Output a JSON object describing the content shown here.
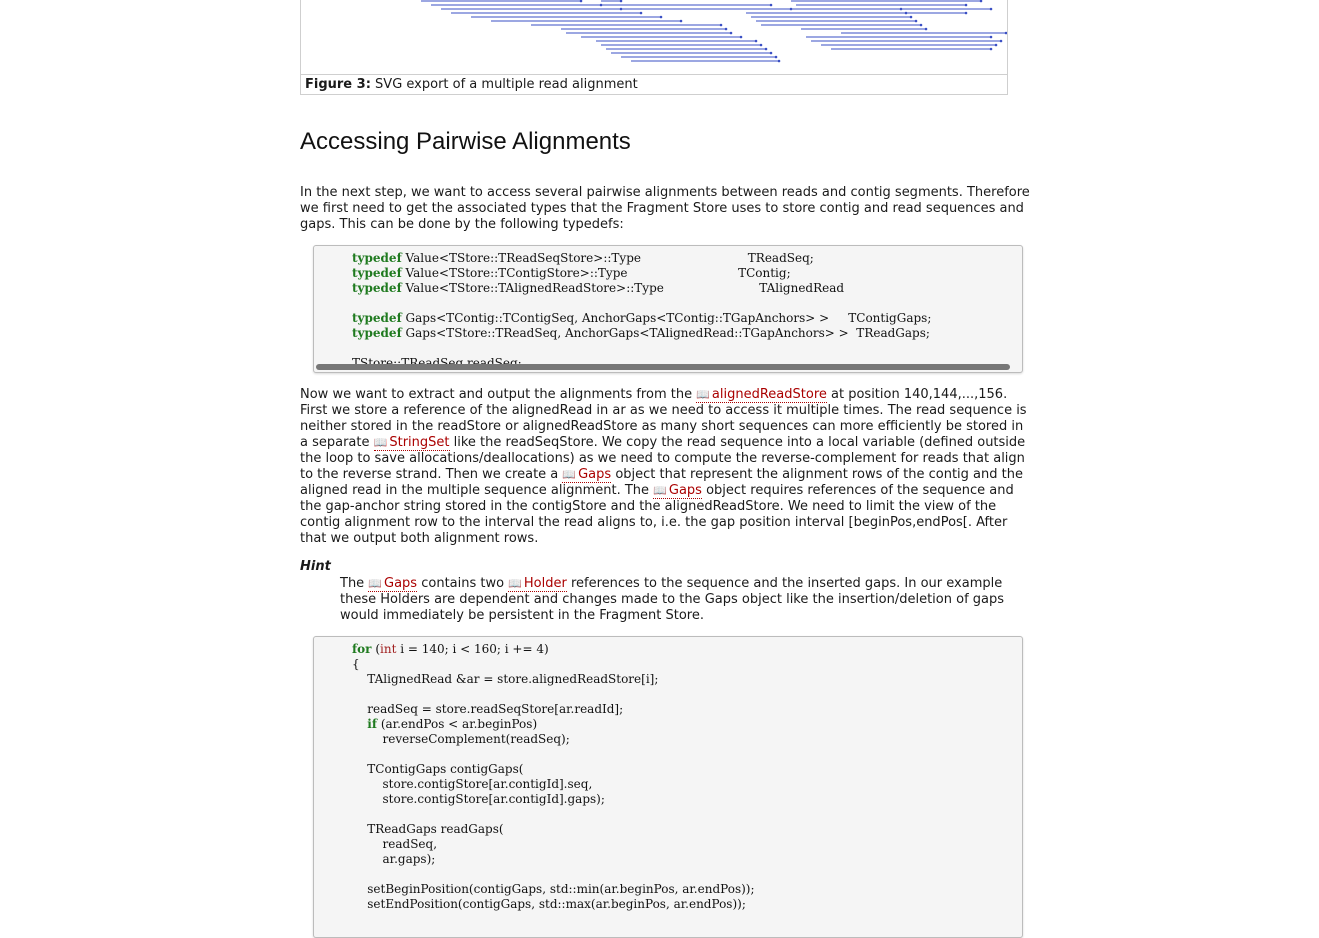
{
  "figure": {
    "caption_label": "Figure 3:",
    "caption_text": "SVG export of a multiple read alignment",
    "line_color": "#3a4fc4"
  },
  "section": {
    "heading": "Accessing Pairwise Alignments"
  },
  "intro": {
    "text": "In the next step, we want to access several pairwise alignments between reads and contig segments. Therefore we first need to get the associated types that the Fragment Store uses to store contig and read sequences and gaps. This can be done by the following typedefs:"
  },
  "code1": {
    "lines": [
      [
        "typedef",
        " Value<TStore::TReadSeqStore>::Type",
        "                            TReadSeq;"
      ],
      [
        "typedef",
        " Value<TStore::TContigStore>::Type",
        "                             TContig;"
      ],
      [
        "typedef",
        " Value<TStore::TAlignedReadStore>::Type",
        "                         TAlignedRead"
      ],
      [
        "",
        "",
        ""
      ],
      [
        "typedef",
        " Gaps<TContig::TContigSeq, AnchorGaps<TContig::TGapAnchors> >",
        "     TContigGaps;"
      ],
      [
        "typedef",
        " Gaps<TStore::TReadSeq, AnchorGaps<TAlignedRead::TGapAnchors> >",
        "  TReadGaps;"
      ],
      [
        "",
        "",
        ""
      ],
      [
        "",
        "TStore::TReadSeq readSeq;",
        ""
      ]
    ]
  },
  "para2": {
    "t1": "Now we want to extract and output the alignments from the ",
    "link1": "alignedReadStore",
    "t2": " at position 140,144,...,156. First we store a reference of the alignedRead in ar as we need to access it multiple times. The read sequence is neither stored in the readStore or alignedReadStore as many short sequences can more efficiently be stored in a separate ",
    "link2": "StringSet",
    "t3": " like the readSeqStore. We copy the read sequence into a local variable (defined outside the loop to save allocations/deallocations) as we need to compute the reverse-complement for reads that align to the reverse strand. Then we create a ",
    "link3": "Gaps",
    "t4": " object that represent the alignment rows of the contig and the aligned read in the multiple sequence alignment. The ",
    "link4": "Gaps",
    "t5": " object requires references of the sequence and the gap-anchor string stored in the contigStore and the alignedReadStore. We need to limit the view of the contig alignment row to the interval the read aligns to, i.e. the gap position interval [beginPos,endPos[. After that we output both alignment rows."
  },
  "hint": {
    "title": "Hint",
    "t1": "The ",
    "link1": "Gaps",
    "t2": " contains two ",
    "link2": "Holder",
    "t3": " references to the sequence and the inserted gaps. In our example these Holders are dependent and changes made to the Gaps object like the insertion/deletion of gaps would immediately be persistent in the Fragment Store."
  },
  "code2": {
    "for_kw": "for",
    "for_open": " (",
    "int_kw": "int",
    "for_rest": " i = 140; i < 160; i += 4)",
    "brace": "{",
    "l1": "    TAlignedRead &ar = store.alignedReadStore[i];",
    "l2": "    readSeq = store.readSeqStore[ar.readId];",
    "if_kw": "if",
    "l3": " (ar.endPos < ar.beginPos)",
    "l4": "        reverseComplement(readSeq);",
    "l5": "    TContigGaps contigGaps(",
    "l6": "        store.contigStore[ar.contigId].seq,",
    "l7": "        store.contigStore[ar.contigId].gaps);",
    "l8": "    TReadGaps readGaps(",
    "l9": "        readSeq,",
    "l10": "        ar.gaps);",
    "l11": "    setBeginPosition(contigGaps, std::min(ar.beginPos, ar.endPos));",
    "l12": "    setEndPosition(contigGaps, std::max(ar.beginPos, ar.endPos));"
  }
}
